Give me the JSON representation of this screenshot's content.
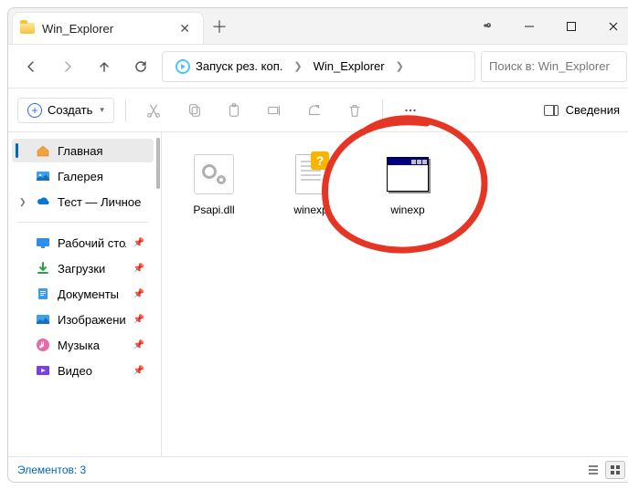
{
  "tab": {
    "title": "Win_Explorer"
  },
  "breadcrumb": {
    "root": "Запуск рез. коп.",
    "current": "Win_Explorer"
  },
  "search": {
    "placeholder": "Поиск в: Win_Explorer"
  },
  "commands": {
    "create": "Создать",
    "details": "Сведения"
  },
  "sidebar": {
    "home": "Главная",
    "gallery": "Галерея",
    "personal": "Тест — Личное",
    "desktop": "Рабочий стол",
    "downloads": "Загрузки",
    "documents": "Документы",
    "pictures": "Изображения",
    "music": "Музыка",
    "videos": "Видео"
  },
  "files": [
    {
      "name": "Psapi.dll"
    },
    {
      "name": "winexp"
    },
    {
      "name": "winexp"
    }
  ],
  "status": {
    "count_label": "Элементов: 3"
  }
}
